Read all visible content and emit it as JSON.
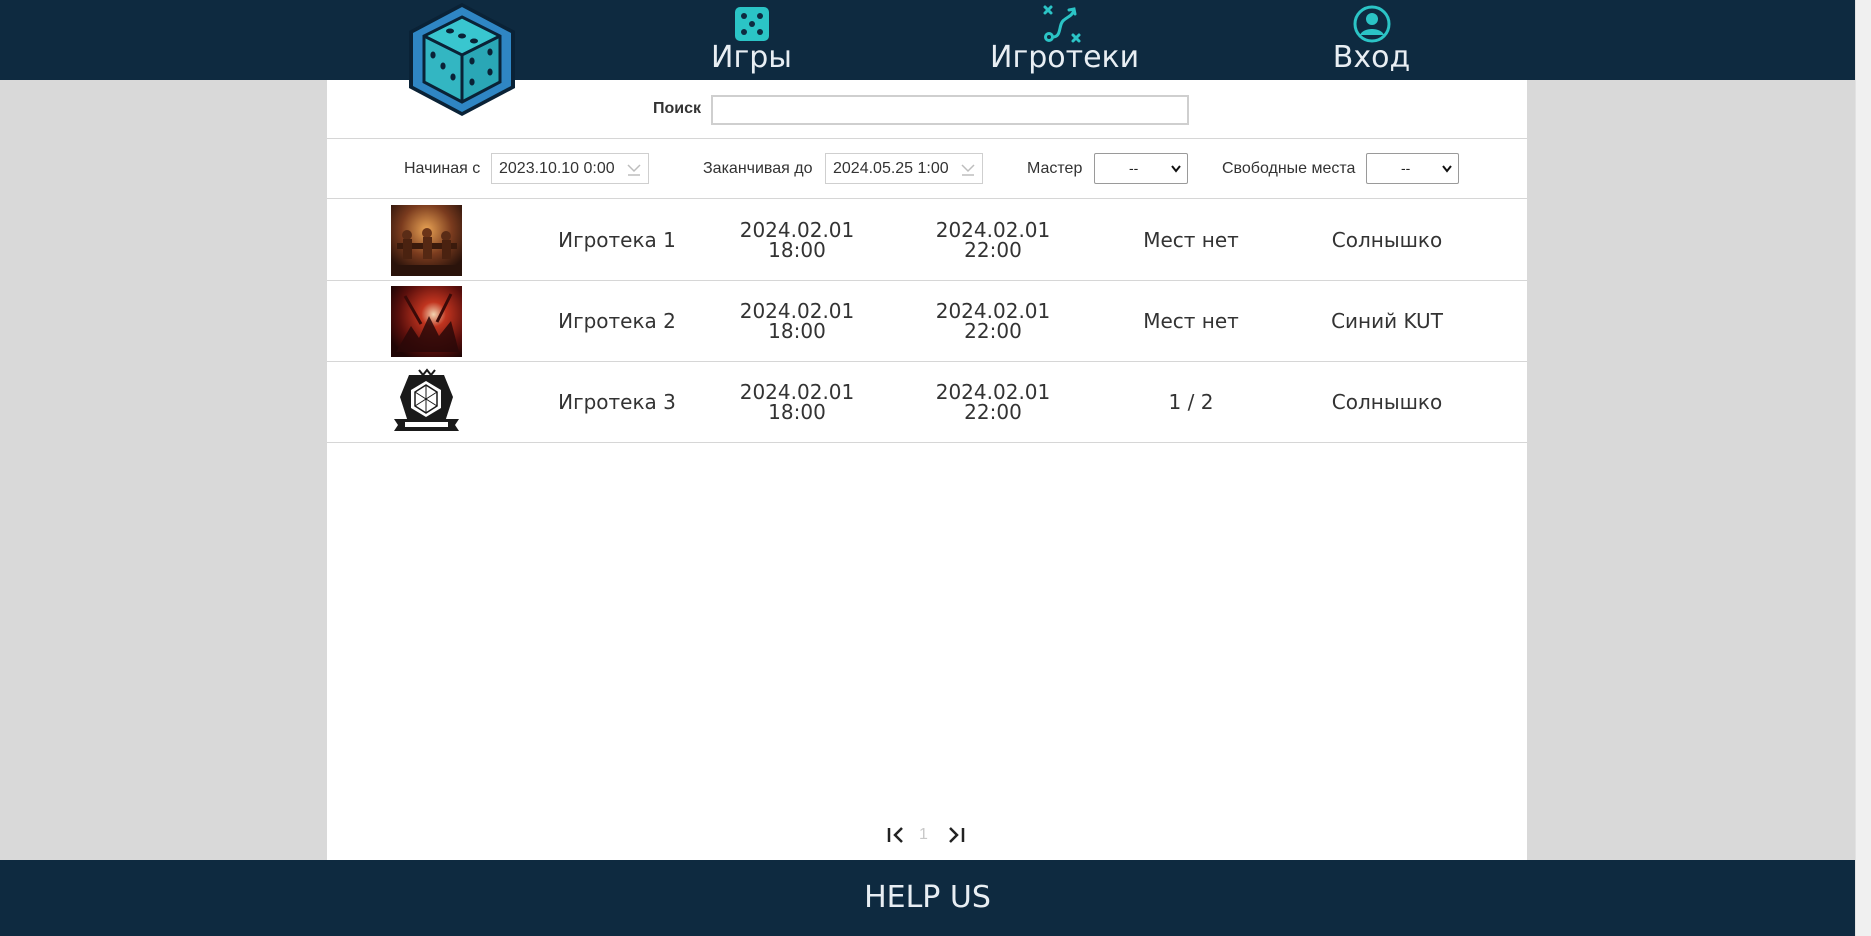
{
  "nav": {
    "games_label": "Игры",
    "clubs_label": "Игротеки",
    "login_label": "Вход",
    "icon_color": "#2bc4c6",
    "bar_color": "#0e2a40"
  },
  "search": {
    "label": "Поиск",
    "value": "",
    "placeholder": ""
  },
  "filters": {
    "start_label": "Начиная с",
    "start_value": "2023.10.10 0:00",
    "end_label": "Заканчивая до",
    "end_value": "2024.05.25 1:00",
    "master_label": "Мастер",
    "master_value": "--",
    "seats_label": "Свободные места",
    "seats_value": "--"
  },
  "events": [
    {
      "name": "Игротека 1",
      "start_date": "2024.02.01",
      "start_time": "18:00",
      "end_date": "2024.02.01",
      "end_time": "22:00",
      "seats": "Мест нет",
      "master": "Солнышко",
      "image": "tavern-scene"
    },
    {
      "name": "Игротека 2",
      "start_date": "2024.02.01",
      "start_time": "18:00",
      "end_date": "2024.02.01",
      "end_time": "22:00",
      "seats": "Мест нет",
      "master": "Синий KUT",
      "image": "red-battle-scene"
    },
    {
      "name": "Игротека 3",
      "start_date": "2024.02.01",
      "start_time": "18:00",
      "end_date": "2024.02.01",
      "end_time": "22:00",
      "seats": "1 / 2",
      "master": "Солнышко",
      "image": "dice-emblem"
    }
  ],
  "pagination": {
    "current_page": "1"
  },
  "footer": {
    "label": "HELP US"
  }
}
